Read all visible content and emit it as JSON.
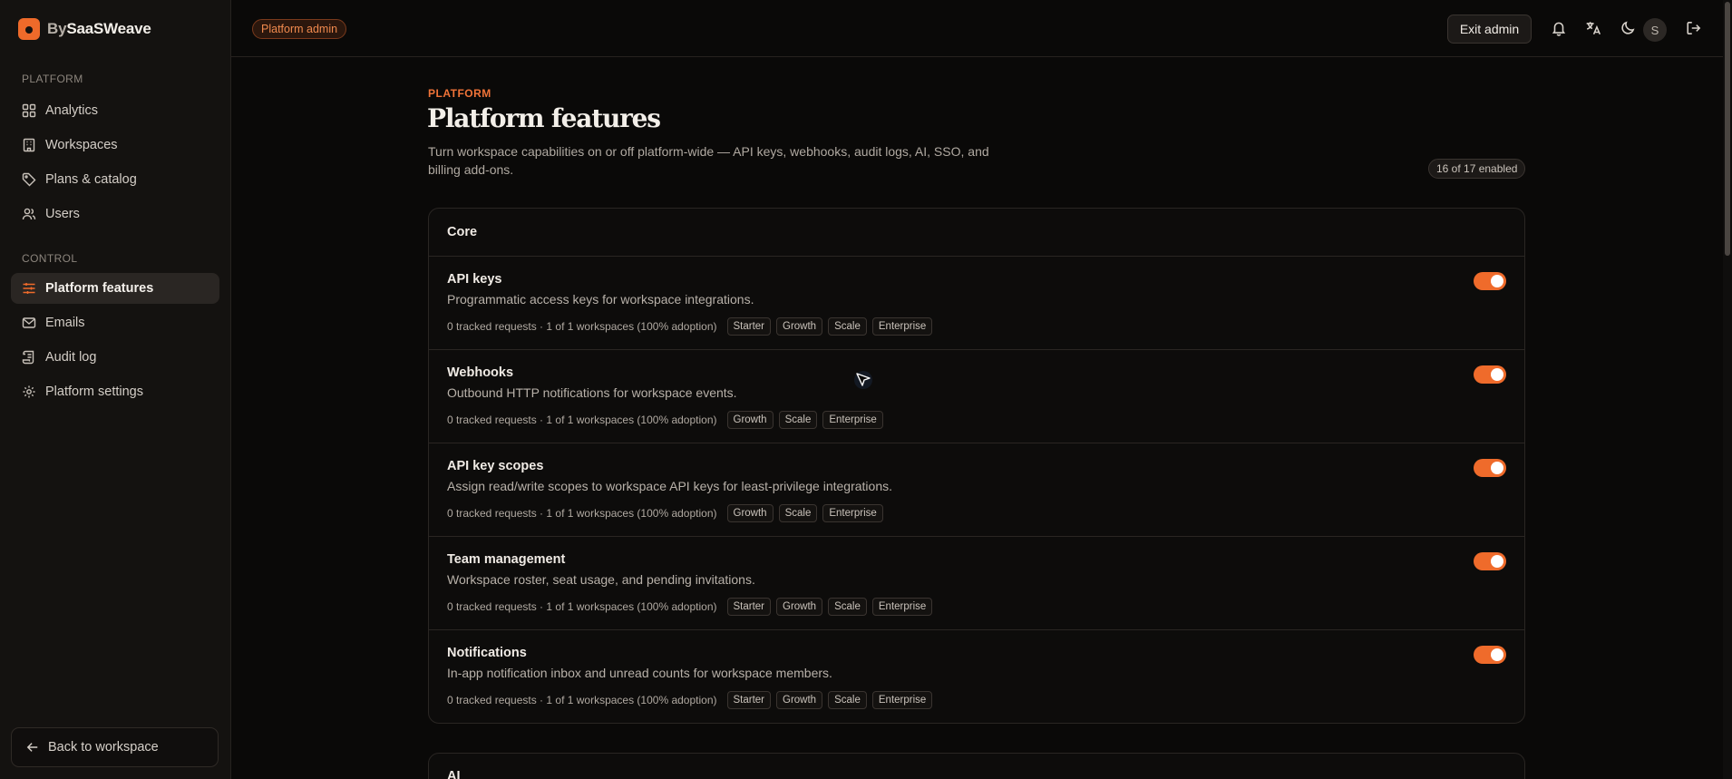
{
  "brand": {
    "prefix": "By",
    "name": "SaaSWeave"
  },
  "sidebar": {
    "sections": [
      {
        "label": "PLATFORM",
        "items": [
          {
            "label": "Analytics",
            "icon": "grid-icon"
          },
          {
            "label": "Workspaces",
            "icon": "building-icon"
          },
          {
            "label": "Plans & catalog",
            "icon": "tag-icon"
          },
          {
            "label": "Users",
            "icon": "users-icon"
          }
        ]
      },
      {
        "label": "CONTROL",
        "items": [
          {
            "label": "Platform features",
            "icon": "sliders-icon",
            "active": true
          },
          {
            "label": "Emails",
            "icon": "mail-icon"
          },
          {
            "label": "Audit log",
            "icon": "scroll-icon"
          },
          {
            "label": "Platform settings",
            "icon": "gear-icon"
          }
        ]
      }
    ],
    "back_label": "Back to workspace"
  },
  "topbar": {
    "badge": "Platform admin",
    "exit_label": "Exit admin",
    "avatar_initial": "S"
  },
  "main": {
    "eyebrow": "PLATFORM",
    "title": "Platform features",
    "description": "Turn workspace capabilities on or off platform-wide — API keys, webhooks, audit logs, AI, SSO, and billing add-ons.",
    "enabled_count": "16 of 17 enabled"
  },
  "groups": [
    {
      "title": "Core",
      "features": [
        {
          "name": "API keys",
          "description": "Programmatic access keys for workspace integrations.",
          "stats": "0 tracked requests · 1 of 1 workspaces (100% adoption)",
          "plans": [
            "Starter",
            "Growth",
            "Scale",
            "Enterprise"
          ],
          "enabled": true
        },
        {
          "name": "Webhooks",
          "description": "Outbound HTTP notifications for workspace events.",
          "stats": "0 tracked requests · 1 of 1 workspaces (100% adoption)",
          "plans": [
            "Growth",
            "Scale",
            "Enterprise"
          ],
          "enabled": true
        },
        {
          "name": "API key scopes",
          "description": "Assign read/write scopes to workspace API keys for least-privilege integrations.",
          "stats": "0 tracked requests · 1 of 1 workspaces (100% adoption)",
          "plans": [
            "Growth",
            "Scale",
            "Enterprise"
          ],
          "enabled": true
        },
        {
          "name": "Team management",
          "description": "Workspace roster, seat usage, and pending invitations.",
          "stats": "0 tracked requests · 1 of 1 workspaces (100% adoption)",
          "plans": [
            "Starter",
            "Growth",
            "Scale",
            "Enterprise"
          ],
          "enabled": true
        },
        {
          "name": "Notifications",
          "description": "In-app notification inbox and unread counts for workspace members.",
          "stats": "0 tracked requests · 1 of 1 workspaces (100% adoption)",
          "plans": [
            "Starter",
            "Growth",
            "Scale",
            "Enterprise"
          ],
          "enabled": true
        }
      ]
    },
    {
      "title": "AI",
      "features": []
    }
  ],
  "colors": {
    "accent": "#ef6b2b",
    "background": "#0a0908",
    "sidebar": "#141210"
  }
}
